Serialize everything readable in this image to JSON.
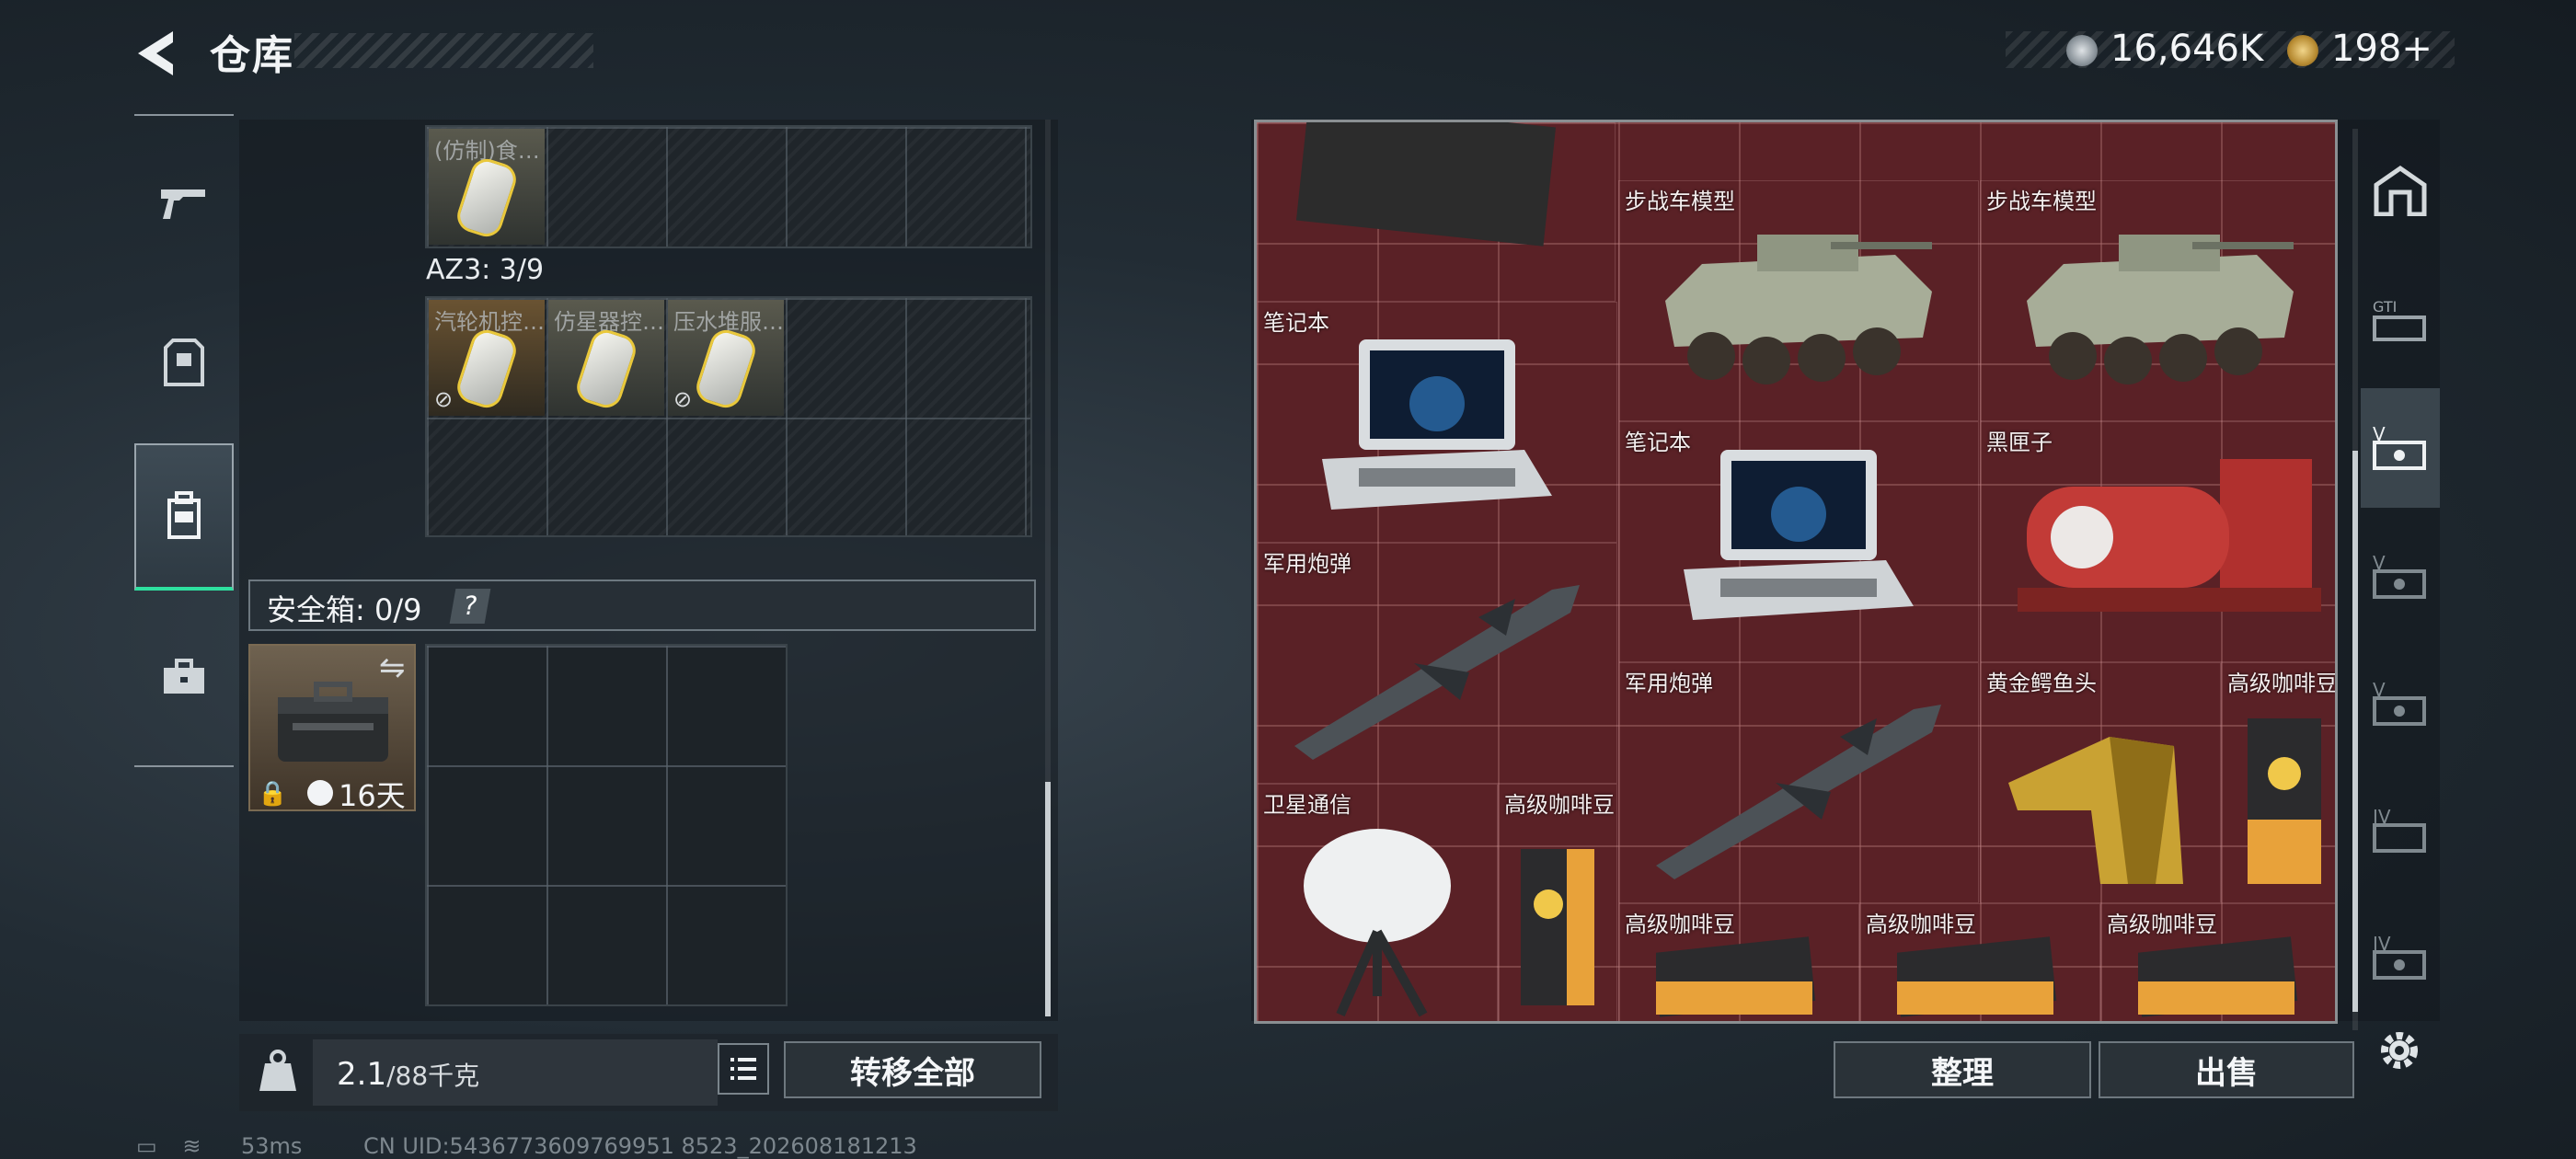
{
  "header": {
    "title": "仓库",
    "back_icon": "back-arrow-icon"
  },
  "currency": {
    "silver": "16,646K",
    "gold": "198+"
  },
  "left_tabs": [
    {
      "icon": "pistol-icon",
      "active": false
    },
    {
      "icon": "armor-icon",
      "active": false
    },
    {
      "icon": "backpack-icon",
      "active": true
    },
    {
      "icon": "briefcase-icon",
      "active": false
    }
  ],
  "container_a": {
    "slots": [
      {
        "label": "(仿制)食…"
      }
    ]
  },
  "container_b": {
    "label": "AZ3: 3/9",
    "slots": [
      {
        "label": "汽轮机控…"
      },
      {
        "label": "仿星器控…"
      },
      {
        "label": "压水堆服…"
      }
    ]
  },
  "safe_box": {
    "label": "安全箱: 0/9",
    "help": "?",
    "case_duration": "16天"
  },
  "weight": {
    "current": "2.1",
    "max": "/88千克"
  },
  "buttons": {
    "transfer_all": "转移全部",
    "sort": "整理",
    "sell": "出售"
  },
  "stash_items": [
    {
      "label": "",
      "kind": "cloth"
    },
    {
      "label": "步战车模型",
      "kind": "ifv"
    },
    {
      "label": "步战车模型",
      "kind": "ifv"
    },
    {
      "label": "笔记本",
      "kind": "laptop"
    },
    {
      "label": "笔记本",
      "kind": "laptop"
    },
    {
      "label": "黑匣子",
      "kind": "blackbox"
    },
    {
      "label": "军用炮弹",
      "kind": "missile"
    },
    {
      "label": "军用炮弹",
      "kind": "missile"
    },
    {
      "label": "黄金鳄鱼头",
      "kind": "golden-croc"
    },
    {
      "label": "高级咖啡豆",
      "kind": "coffee"
    },
    {
      "label": "卫星通信",
      "kind": "satellite"
    },
    {
      "label": "高级咖啡豆",
      "kind": "coffee"
    },
    {
      "label": "高级咖啡豆",
      "kind": "coffee"
    },
    {
      "label": "高级咖啡豆",
      "kind": "coffee"
    },
    {
      "label": "高级咖啡豆",
      "kind": "coffee"
    }
  ],
  "right_tabs": [
    {
      "icon": "safehouse-icon",
      "label": ""
    },
    {
      "icon": "gti-stash-icon",
      "label": "GTI"
    },
    {
      "icon": "stash-v-icon",
      "label": "V",
      "active": true
    },
    {
      "icon": "stash-v-icon",
      "label": "V"
    },
    {
      "icon": "stash-v-icon",
      "label": "V"
    },
    {
      "icon": "stash-iv-icon",
      "label": "IV"
    },
    {
      "icon": "stash-iv-icon",
      "label": "IV"
    }
  ],
  "status": {
    "latency": "53ms",
    "uid": "CN UID:5436773609769951 8523_202608181213"
  }
}
